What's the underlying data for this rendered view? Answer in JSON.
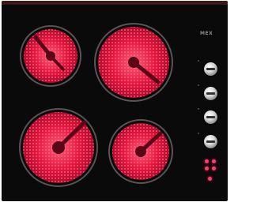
{
  "appliance": {
    "type": "ceramic electric hob",
    "model_text": "",
    "brand_logo": "MEX"
  },
  "colors": {
    "glass": "#0a0a0a",
    "zone_glow": "#e1153b",
    "zone_coil": "#ff4d6a",
    "led": "#ff3b6e",
    "knob": "#d8d8d8"
  },
  "zones": [
    {
      "name": "front-left-zone",
      "state": "on"
    },
    {
      "name": "back-left-zone",
      "state": "on"
    },
    {
      "name": "back-right-zone",
      "state": "on"
    },
    {
      "name": "front-right-zone",
      "state": "on"
    }
  ],
  "controls": {
    "knob_count": 4,
    "indicator_led_count": 5
  }
}
